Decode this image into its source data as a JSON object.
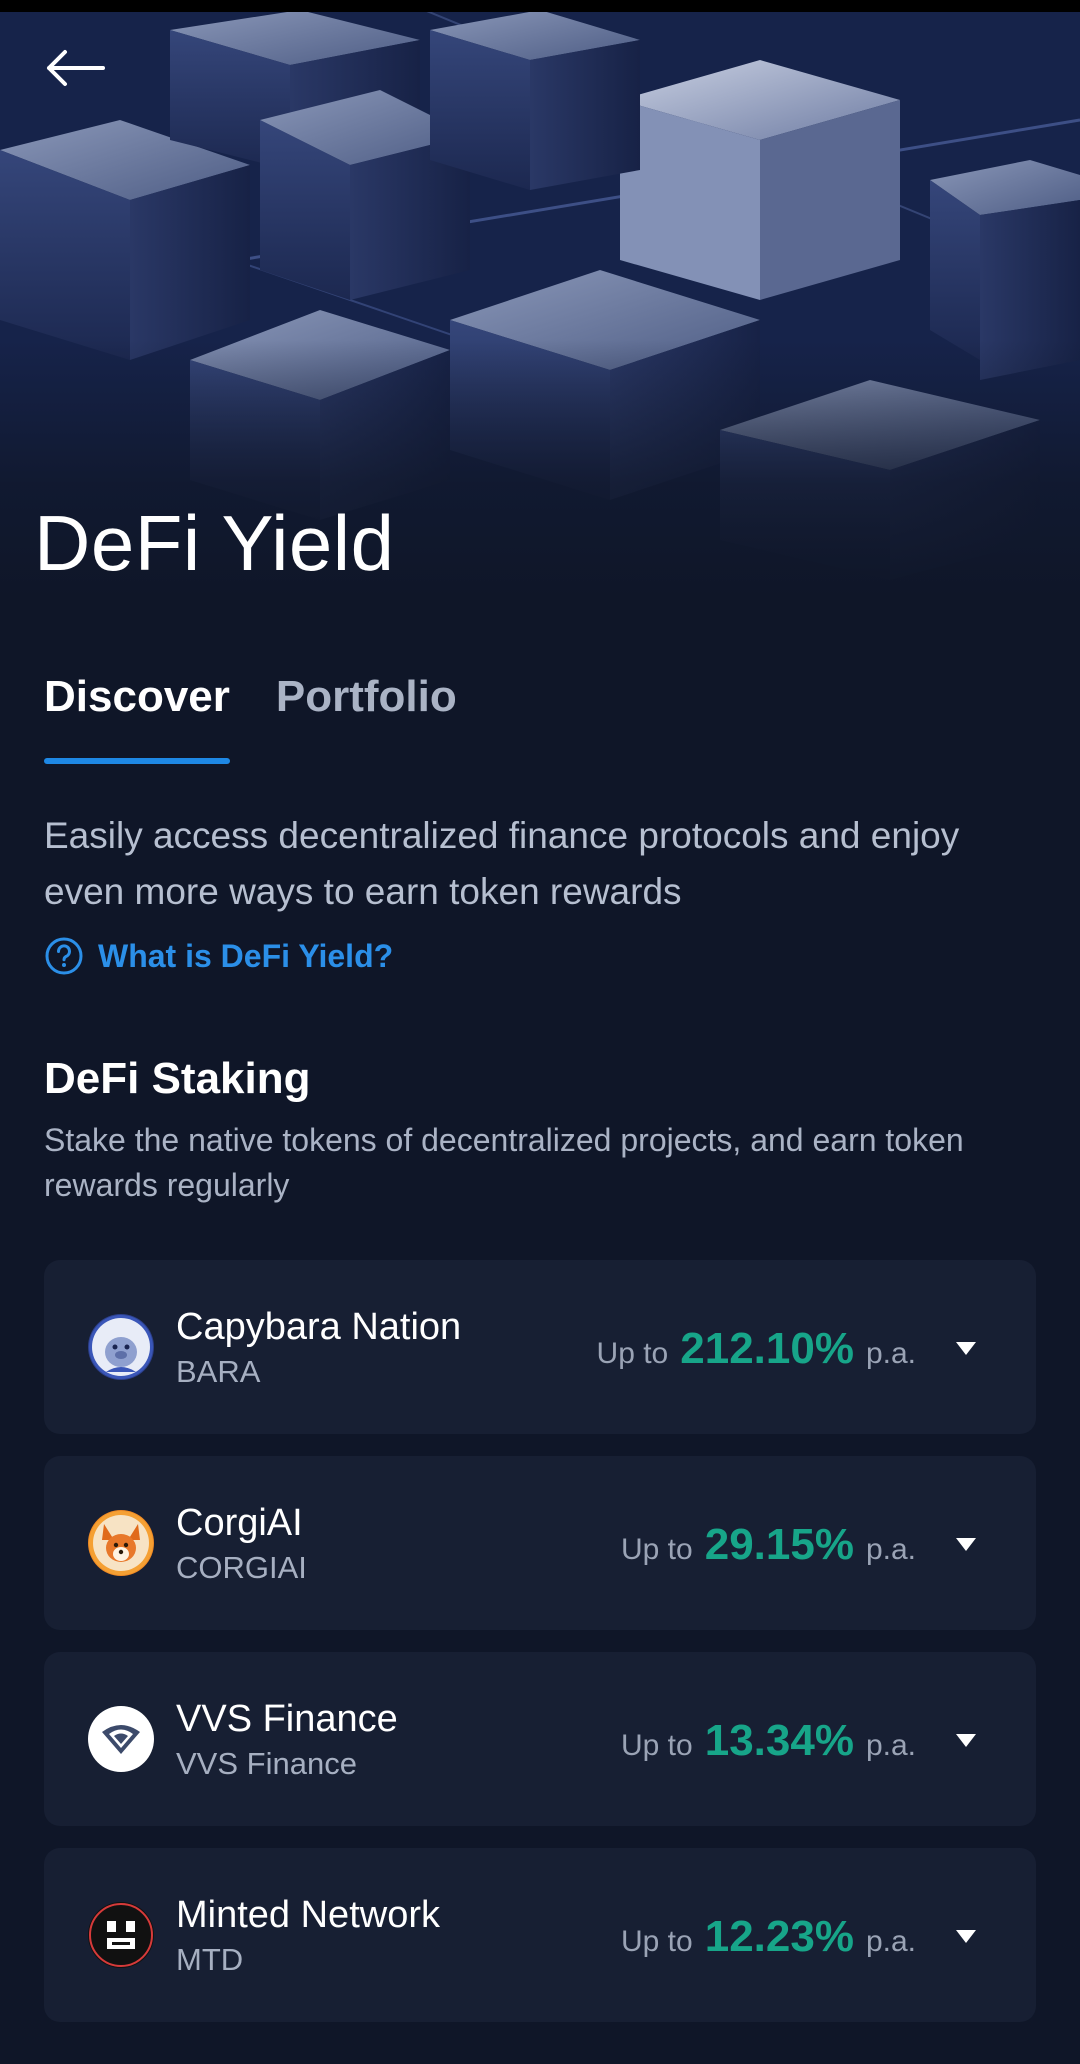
{
  "header": {
    "title": "DeFi Yield",
    "back_icon": "arrow-left-icon"
  },
  "tabs": [
    {
      "label": "Discover",
      "active": true
    },
    {
      "label": "Portfolio",
      "active": false
    }
  ],
  "intro": {
    "text": "Easily access decentralized finance protocols and enjoy even more ways to earn token rewards",
    "help_link": "What is DeFi Yield?",
    "help_icon": "question-circle-icon"
  },
  "staking": {
    "title": "DeFi Staking",
    "description": "Stake the native tokens of decentralized projects, and earn token rewards regularly",
    "items": [
      {
        "name": "Capybara Nation",
        "symbol": "BARA",
        "apy_prefix": "Up to",
        "apy": "212.10%",
        "apy_suffix": "p.a.",
        "logo": "capybara-logo-icon"
      },
      {
        "name": "CorgiAI",
        "symbol": "CORGIAI",
        "apy_prefix": "Up to",
        "apy": "29.15%",
        "apy_suffix": "p.a.",
        "logo": "corgi-logo-icon"
      },
      {
        "name": "VVS Finance",
        "symbol": "VVS Finance",
        "apy_prefix": "Up to",
        "apy": "13.34%",
        "apy_suffix": "p.a.",
        "logo": "vvs-logo-icon"
      },
      {
        "name": "Minted Network",
        "symbol": "MTD",
        "apy_prefix": "Up to",
        "apy": "12.23%",
        "apy_suffix": "p.a.",
        "logo": "minted-logo-icon"
      }
    ]
  },
  "colors": {
    "background": "#0f1628",
    "card": "#171f33",
    "accent_blue": "#1e88e5",
    "apy_green": "#17a589"
  }
}
